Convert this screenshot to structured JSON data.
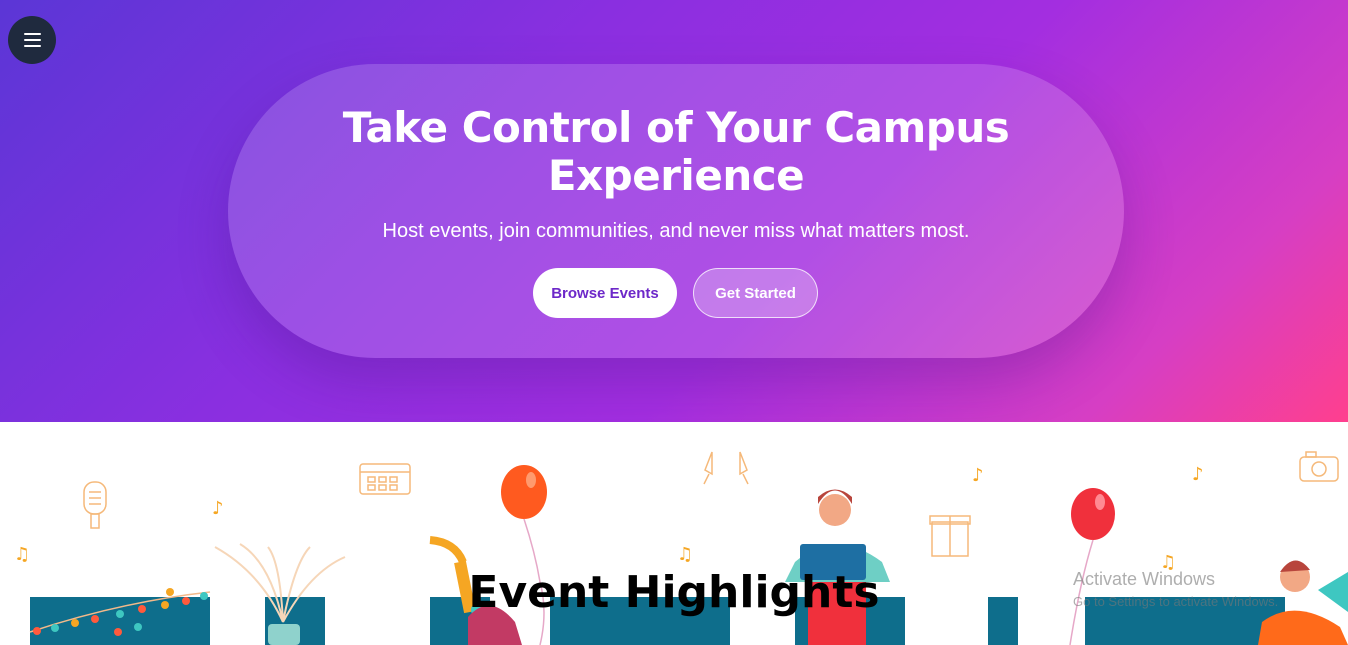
{
  "menu": {
    "icon": "hamburger-icon"
  },
  "hero": {
    "title": "Take Control of Your Campus Experience",
    "subtitle": "Host events, join communities, and never miss what matters most.",
    "browse_label": "Browse Events",
    "start_label": "Get Started"
  },
  "highlights": {
    "title": "Event Highlights"
  },
  "watermark": {
    "line1": "Activate Windows",
    "line2": "Go to Settings to activate Windows."
  },
  "colors": {
    "menu_bg": "#1f2a3e",
    "accent_purple": "#6d28c9",
    "gradient_start": "#5b36d6",
    "gradient_end": "#ff3f8e",
    "illustration_teal": "#0e6e8c",
    "illustration_orange": "#f5a623"
  }
}
